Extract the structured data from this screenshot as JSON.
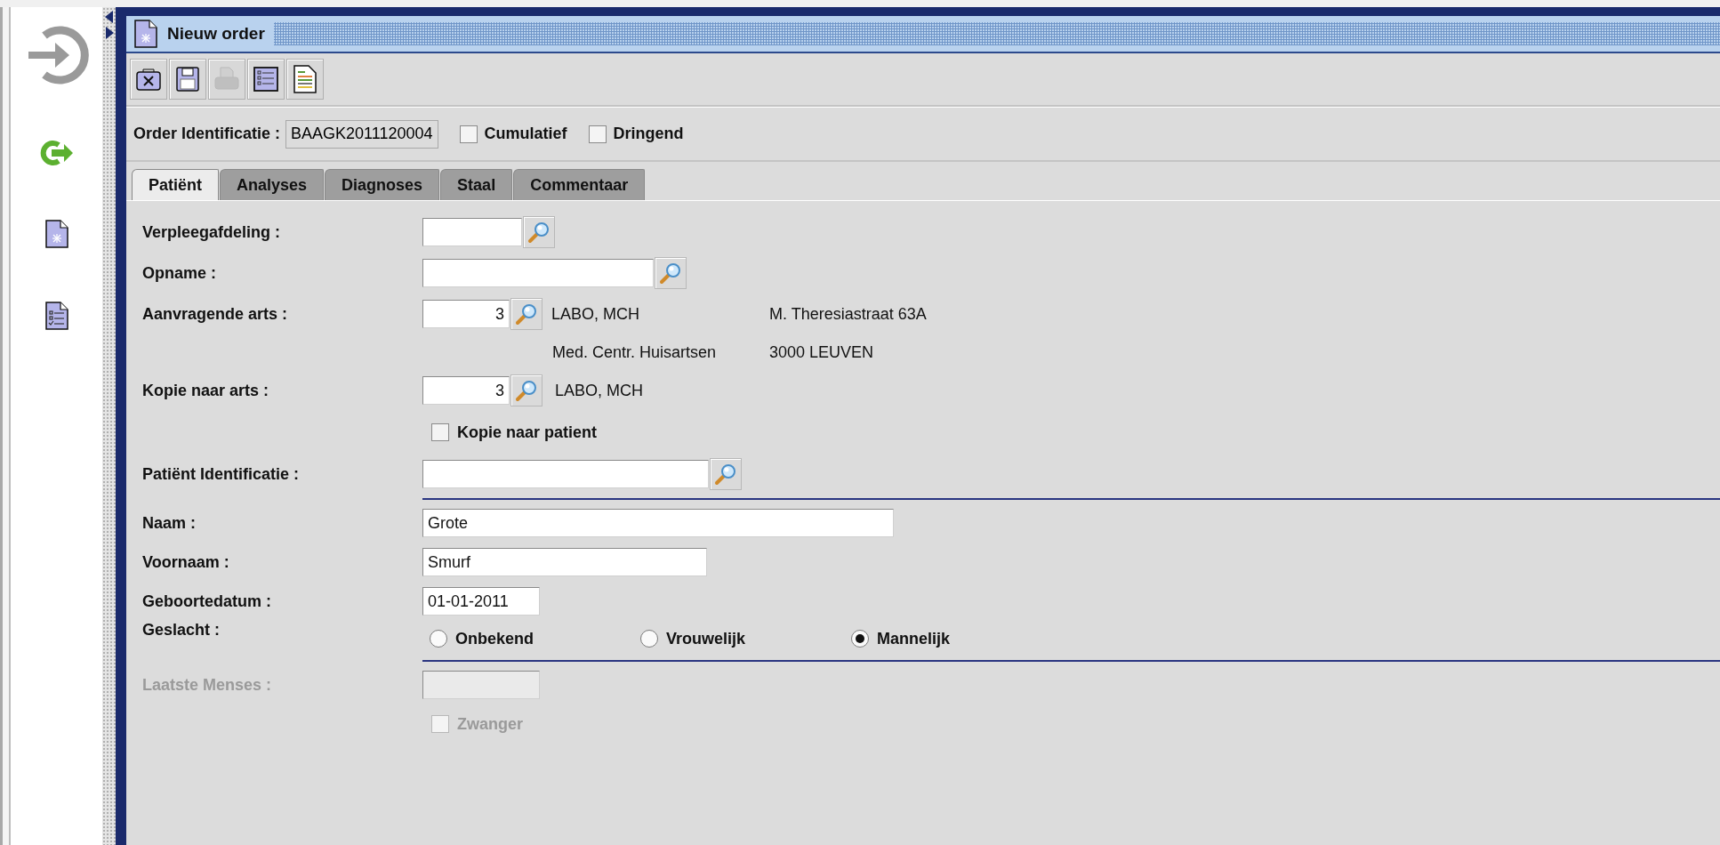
{
  "window": {
    "title": "Nieuw order"
  },
  "toolbar": {
    "buttons": [
      {
        "kind": "delete",
        "disabled": false
      },
      {
        "kind": "save",
        "disabled": false
      },
      {
        "kind": "print",
        "disabled": true
      },
      {
        "kind": "list",
        "disabled": false
      },
      {
        "kind": "report",
        "disabled": false
      }
    ]
  },
  "order": {
    "label": "Order Identificatie :",
    "value": "BAAGK2011120004",
    "options": [
      {
        "label": "Cumulatief",
        "checked": false
      },
      {
        "label": "Dringend",
        "checked": false
      }
    ]
  },
  "tabs": [
    {
      "label": "Patiënt",
      "selected": true
    },
    {
      "label": "Analyses",
      "selected": false
    },
    {
      "label": "Diagnoses",
      "selected": false
    },
    {
      "label": "Staal",
      "selected": false
    },
    {
      "label": "Commentaar",
      "selected": false
    }
  ],
  "form": {
    "ward": {
      "label": "Verpleegafdeling :"
    },
    "admission": {
      "label": "Opname :"
    },
    "requesting_doctor": {
      "label": "Aanvragende arts :",
      "value": "3",
      "name": "LABO, MCH",
      "address": "M. Theresiastraat 63A",
      "organisation": "Med. Centr. Huisartsen",
      "city": "3000 LEUVEN"
    },
    "copy_doctor": {
      "label": "Kopie naar arts :",
      "value": "3",
      "name": "LABO, MCH"
    },
    "copy_patient": {
      "label": "Kopie naar patient",
      "checked": false
    },
    "patient_id": {
      "label": "Patiënt Identificatie :"
    },
    "last_name": {
      "label": "Naam :",
      "value": "Grote"
    },
    "first_name": {
      "label": "Voornaam :",
      "value": "Smurf"
    },
    "birth_date": {
      "label": "Geboortedatum :",
      "value": "01-01-2011"
    },
    "gender": {
      "label": "Geslacht :",
      "options": [
        {
          "label": "Onbekend",
          "selected": false
        },
        {
          "label": "Vrouwelijk",
          "selected": false
        },
        {
          "label": "Mannelijk",
          "selected": true
        }
      ]
    },
    "last_menses": {
      "label": "Laatste Menses :",
      "disabled": true
    },
    "pregnant": {
      "label": "Zwanger",
      "checked": false,
      "disabled": true
    }
  }
}
